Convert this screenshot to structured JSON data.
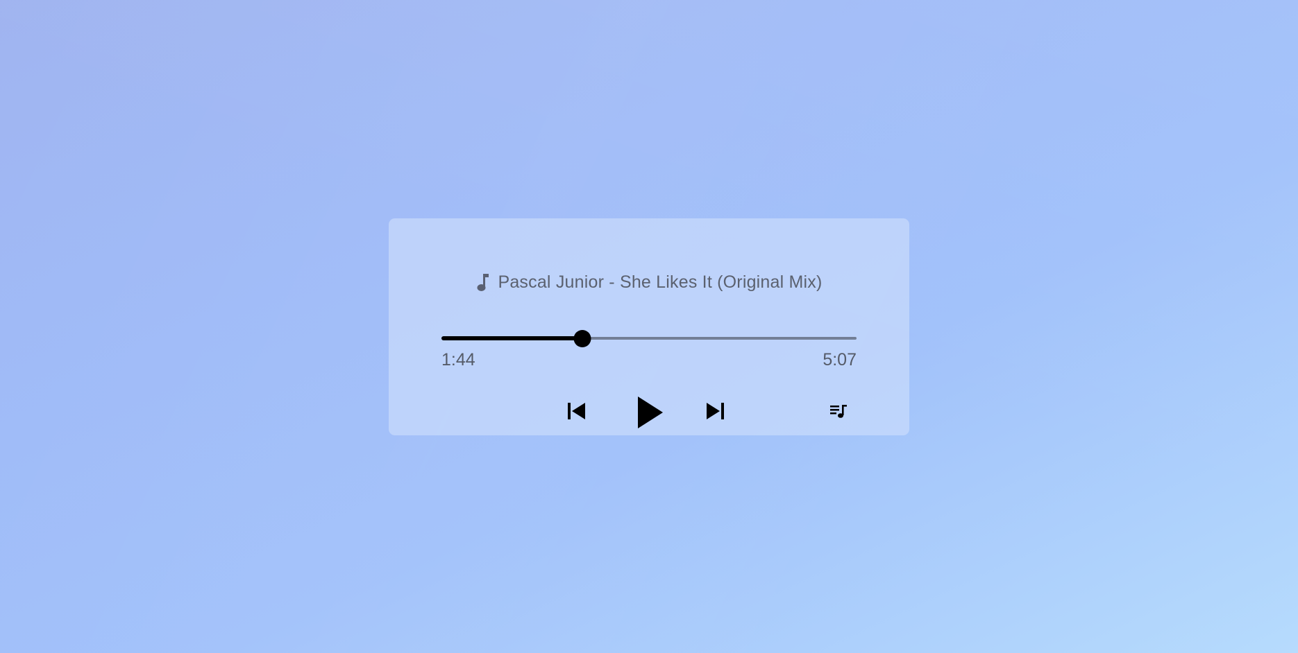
{
  "player": {
    "track_title": "Pascal Junior - She Likes It (Original Mix)",
    "current_time": "1:44",
    "total_time": "5:07",
    "progress_fraction": 0.339,
    "icons": {
      "title": "music-note-icon",
      "previous": "skip-previous-icon",
      "play": "play-icon",
      "next": "skip-next-icon",
      "queue": "queue-music-icon"
    },
    "colors": {
      "progress_fill": "#000000",
      "progress_track": "#737f96",
      "text": "#5b616f"
    }
  }
}
